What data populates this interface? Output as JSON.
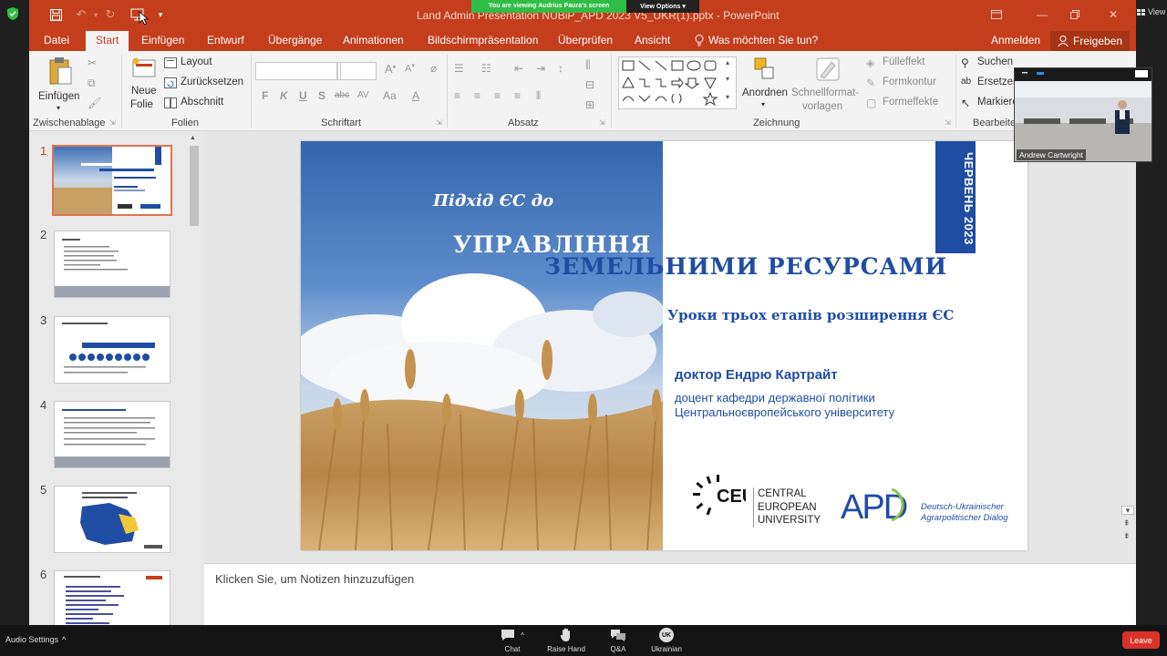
{
  "zoom": {
    "banner_viewing": "You are viewing Audrius Paura's screen",
    "banner_view_options": "View Options",
    "view_label": "View",
    "audio_settings": "Audio Settings",
    "toolbar": [
      {
        "id": "chat",
        "label": "Chat"
      },
      {
        "id": "raise-hand",
        "label": "Raise Hand"
      },
      {
        "id": "qa",
        "label": "Q&A"
      },
      {
        "id": "language",
        "label": "Ukrainian",
        "badge": "UK"
      }
    ],
    "leave_label": "Leave",
    "participant_name": "Andrew Cartwright"
  },
  "app": {
    "title": "Land Admin Presentation NUBiP_APD 2023 V5_UKR(1).pptx - PowerPoint",
    "tabs": [
      "Datei",
      "Start",
      "Einfügen",
      "Entwurf",
      "Übergänge",
      "Animationen",
      "Bildschirmpräsentation",
      "Überprüfen",
      "Ansicht"
    ],
    "active_tab": "Start",
    "tell_me": "Was möchten Sie tun?",
    "sign_in": "Anmelden",
    "share": "Freigeben"
  },
  "ribbon": {
    "clipboard": {
      "paste": "Einfügen",
      "label": "Zwischenablage"
    },
    "slides": {
      "new_slide_1": "Neue",
      "new_slide_2": "Folie",
      "layout": "Layout",
      "reset": "Zurücksetzen",
      "section": "Abschnitt",
      "label": "Folien"
    },
    "font": {
      "label": "Schriftart",
      "bold": "F",
      "italic": "K",
      "underline": "U",
      "shadow": "S",
      "strike": "abc",
      "spacing": "AV",
      "case": "Aa",
      "color": "A"
    },
    "paragraph": {
      "label": "Absatz"
    },
    "drawing": {
      "arrange": "Anordnen",
      "quick_styles_1": "Schnellformat-",
      "quick_styles_2": "vorlagen",
      "fill": "Fülleffekt",
      "outline": "Formkontur",
      "effects": "Formeffekte",
      "label": "Zeichnung"
    },
    "editing": {
      "find": "Suchen",
      "replace": "Ersetzen",
      "select": "Markieren",
      "label": "Bearbeiten"
    }
  },
  "slides_pane": {
    "numbers": [
      "1",
      "2",
      "3",
      "4",
      "5",
      "6"
    ],
    "active": "1"
  },
  "slide": {
    "date": "ЧЕРВЕНЬ 2023",
    "subtitle": "Підхід ЄС до",
    "title_line1": "УПРАВЛІННЯ",
    "title_line2": "ЗЕМЕЛЬНИМИ РЕСУРСАМИ",
    "lessons": "Уроки трьох етапів розширення ЄС",
    "author": "доктор Ендрю Картрайт",
    "affiliation_1": "доцент кафедри державної політики",
    "affiliation_2": "Центральноєвропейського університету",
    "ceu_mark": "CEU",
    "ceu_name": "CENTRAL\nEUROPEAN\nUNIVERSITY",
    "apd_mark": "APD",
    "apd_name": "Deutsch-Ukrainischer\nAgrarpolitischer Dialog"
  },
  "notes_placeholder": "Klicken Sie, um Notizen hinzuzufügen",
  "colors": {
    "ppt_accent": "#c43e1c",
    "slide_blue": "#1f4da3",
    "zoom_leave": "#d9322a",
    "zoom_banner": "#2fbd45"
  }
}
